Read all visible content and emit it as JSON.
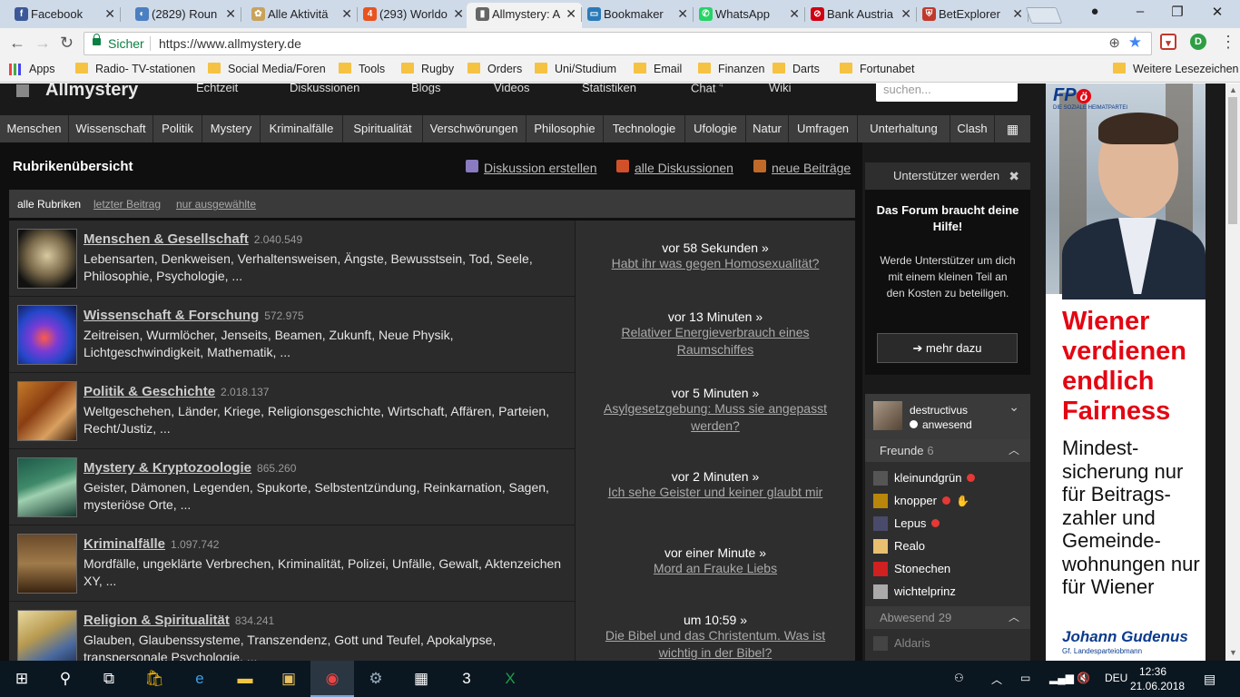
{
  "browser": {
    "tabs": [
      {
        "title": "Facebook",
        "icon": "facebook-icon",
        "color": "#3b5998",
        "glyph": "f",
        "active": false
      },
      {
        "title": "(2829) Roun",
        "icon": "roundcube-icon",
        "color": "#4a7fc1",
        "glyph": "◐",
        "active": false
      },
      {
        "title": "Alle Aktivitä",
        "icon": "activity-icon",
        "color": "#c9a25b",
        "glyph": "✿",
        "active": false
      },
      {
        "title": "(293) Worldo",
        "icon": "worldofdarts-icon",
        "color": "#e8531f",
        "glyph": "4",
        "active": false
      },
      {
        "title": "Allmystery: A",
        "icon": "allmystery-icon",
        "color": "#666666",
        "glyph": "▮",
        "active": true
      },
      {
        "title": "Bookmaker",
        "icon": "bookmaker-icon",
        "color": "#2a7ab8",
        "glyph": "▭",
        "active": false
      },
      {
        "title": "WhatsApp",
        "icon": "whatsapp-icon",
        "color": "#25d366",
        "glyph": "✆",
        "active": false
      },
      {
        "title": "Bank Austria",
        "icon": "bankaustria-icon",
        "color": "#d00010",
        "glyph": "⊘",
        "active": false
      },
      {
        "title": "BetExplorer",
        "icon": "betexplorer-icon",
        "color": "#c0392b",
        "glyph": "⛨",
        "active": false
      }
    ],
    "secure_label": "Sicher",
    "url": "https://www.allmystery.de",
    "bookmarks": [
      {
        "label": "Apps",
        "type": "apps"
      },
      {
        "label": "Radio- TV-stationen",
        "type": "folder"
      },
      {
        "label": "Social Media/Foren",
        "type": "folder"
      },
      {
        "label": "Tools",
        "type": "folder"
      },
      {
        "label": "Rugby",
        "type": "folder"
      },
      {
        "label": "Orders",
        "type": "folder"
      },
      {
        "label": "Uni/Studium",
        "type": "folder"
      },
      {
        "label": "Email",
        "type": "folder"
      },
      {
        "label": "Finanzen",
        "type": "folder"
      },
      {
        "label": "Darts",
        "type": "folder"
      },
      {
        "label": "Fortunabet",
        "type": "folder"
      }
    ],
    "other_bookmarks": "Weitere Lesezeichen"
  },
  "site": {
    "logo": "Allmystery",
    "top_nav": [
      "Echtzeit",
      "Diskussionen",
      "Blogs",
      "Videos",
      "Statistiken",
      "Chat",
      "Wiki"
    ],
    "chat_count": "4",
    "search_placeholder": "suchen...",
    "categories": [
      "Menschen",
      "Wissenschaft",
      "Politik",
      "Mystery",
      "Kriminalfälle",
      "Spiritualität",
      "Verschwörungen",
      "Philosophie",
      "Technologie",
      "Ufologie",
      "Natur",
      "Umfragen",
      "Unterhaltung",
      "Clash"
    ]
  },
  "overview": {
    "title": "Rubrikenübersicht",
    "actions": [
      "Diskussion erstellen",
      "alle Diskussionen",
      "neue Beiträge"
    ],
    "filters": [
      "alle Rubriken",
      "letzter Beitrag",
      "nur ausgewählte"
    ],
    "rows": [
      {
        "title": "Menschen & Gesellschaft",
        "count": "2.040.549",
        "desc": "Lebensarten, Denkweisen, Verhaltensweisen, Ängste, Bewusstsein, Tod, Seele, Philosophie, Psychologie, ...",
        "when": "vor 58 Sekunden »",
        "topic": "Habt ihr was gegen Homosexualität?",
        "thumb": "radial-gradient(circle at 50% 45%,#d9c9a0 0,#7a6a4a 45%,#111 80%)"
      },
      {
        "title": "Wissenschaft & Forschung",
        "count": "572.975",
        "desc": "Zeitreisen, Wurmlöcher, Jenseits, Beamen, Zukunft, Neue Physik, Lichtgeschwindigkeit, Mathematik, ...",
        "when": "vor 13 Minuten »",
        "topic": "Relativer Energieverbrauch eines Raumschiffes",
        "thumb": "radial-gradient(ellipse at 45% 55%,#ff5a4a 0,#7a3bd6 30%,#2447c9 60%,#0c1640 100%)"
      },
      {
        "title": "Politik & Geschichte",
        "count": "2.018.137",
        "desc": "Weltgeschehen, Länder, Kriege, Religionsgeschichte, Wirtschaft, Affären, Parteien, Recht/Justiz, ...",
        "when": "vor 5 Minuten »",
        "topic": "Asylgesetzgebung: Muss sie angepasst werden?",
        "thumb": "linear-gradient(135deg,#c47a2a 0,#8a3e12 40%,#d9a060 70%,#3b1c0a 100%)"
      },
      {
        "title": "Mystery & Kryptozoologie",
        "count": "865.260",
        "desc": "Geister, Dämonen, Legenden, Spukorte, Selbstentzündung, Reinkarnation, Sagen, mysteriöse Orte, ...",
        "when": "vor 2 Minuten »",
        "topic": "Ich sehe Geister und keiner glaubt mir",
        "thumb": "linear-gradient(160deg,#1f5a4a 0,#3f8a6a 40%,#9fd0b0 55%,#143a30 100%)"
      },
      {
        "title": "Kriminalfälle",
        "count": "1.097.742",
        "desc": "Mordfälle, ungeklärte Verbrechen, Kriminalität, Polizei, Unfälle, Gewalt, Aktenzeichen XY, ...",
        "when": "vor einer Minute »",
        "topic": "Mord an Frauke Liebs",
        "thumb": "linear-gradient(180deg,#6a4a2a 0,#a07a4a 50%,#3a2410 100%)"
      },
      {
        "title": "Religion & Spiritualität",
        "count": "834.241",
        "desc": "Glauben, Glaubenssysteme, Transzendenz, Gott und Teufel, Apokalypse, transpersonale Psychologie, ...",
        "when": "um 10:59 »",
        "topic": "Die Bibel und das Christentum. Was ist wichtig in der Bibel?",
        "thumb": "linear-gradient(150deg,#e8d9a0 0,#b89a50 40%,#4a6aa0 70%,#1a2a4a 100%)"
      }
    ]
  },
  "sidebar": {
    "support_header": "Unterstützer werden",
    "support_title": "Das Forum braucht deine Hilfe!",
    "support_text": "Werde Unterstützer um dich mit einem kleinen Teil an den Kosten zu beteiligen.",
    "support_button": "mehr dazu",
    "user_name": "destructivus",
    "user_status": "anwesend",
    "friends_label": "Freunde",
    "friends_count": "6",
    "friends": [
      {
        "name": "kleinundgrün",
        "online": true,
        "extra": "",
        "color": "#555"
      },
      {
        "name": "knopper",
        "online": true,
        "extra": "✋",
        "color": "#b8860b"
      },
      {
        "name": "Lepus",
        "online": true,
        "extra": "",
        "color": "#4a4a6a"
      },
      {
        "name": "Realo",
        "online": false,
        "extra": "",
        "color": "#e8c070"
      },
      {
        "name": "Stonechen",
        "online": false,
        "extra": "",
        "color": "#d02020"
      },
      {
        "name": "wichtelprinz",
        "online": false,
        "extra": "",
        "color": "#aaa"
      }
    ],
    "away_label": "Abwesend",
    "away_count": "29",
    "away": [
      "Aldaris"
    ]
  },
  "ad": {
    "logo": "FP",
    "logo_badge": "ö",
    "logo_sub": "DIE SOZIALE HEIMATPARTEI",
    "headline": "Wiener verdienen endlich Fairness",
    "body": "Mindest-sicherung nur für Beitrags-zahler und Gemeinde-wohnungen nur für Wiener",
    "signature": "Johann Gudenus",
    "signature_sub": "Gf. Landesparteiobmann"
  },
  "taskbar": {
    "language": "DEU",
    "time": "12:36",
    "date": "21.06.2018"
  }
}
